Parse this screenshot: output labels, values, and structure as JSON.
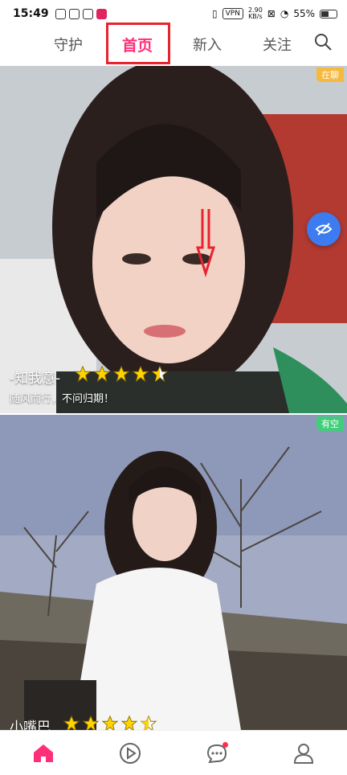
{
  "status_bar": {
    "time": "15:49",
    "vpn": "VPN",
    "net_speed": "2.90",
    "net_unit": "KB/s",
    "battery": "55%"
  },
  "nav": {
    "tabs": [
      {
        "label": "守护"
      },
      {
        "label": "首页"
      },
      {
        "label": "新入"
      },
      {
        "label": "关注"
      }
    ],
    "active_color": "#ff2e78"
  },
  "cards": [
    {
      "badge": "在聊",
      "name": "-知我意-",
      "rating": 4.5,
      "signature": "随风而行，不问归期！"
    },
    {
      "badge": "有空",
      "name": "小嘴巴",
      "rating": 4.5
    }
  ],
  "bottom_nav": [
    {
      "icon": "home-icon",
      "active": true
    },
    {
      "icon": "play-icon"
    },
    {
      "icon": "chat-icon",
      "has_dot": true
    },
    {
      "icon": "profile-icon"
    }
  ]
}
